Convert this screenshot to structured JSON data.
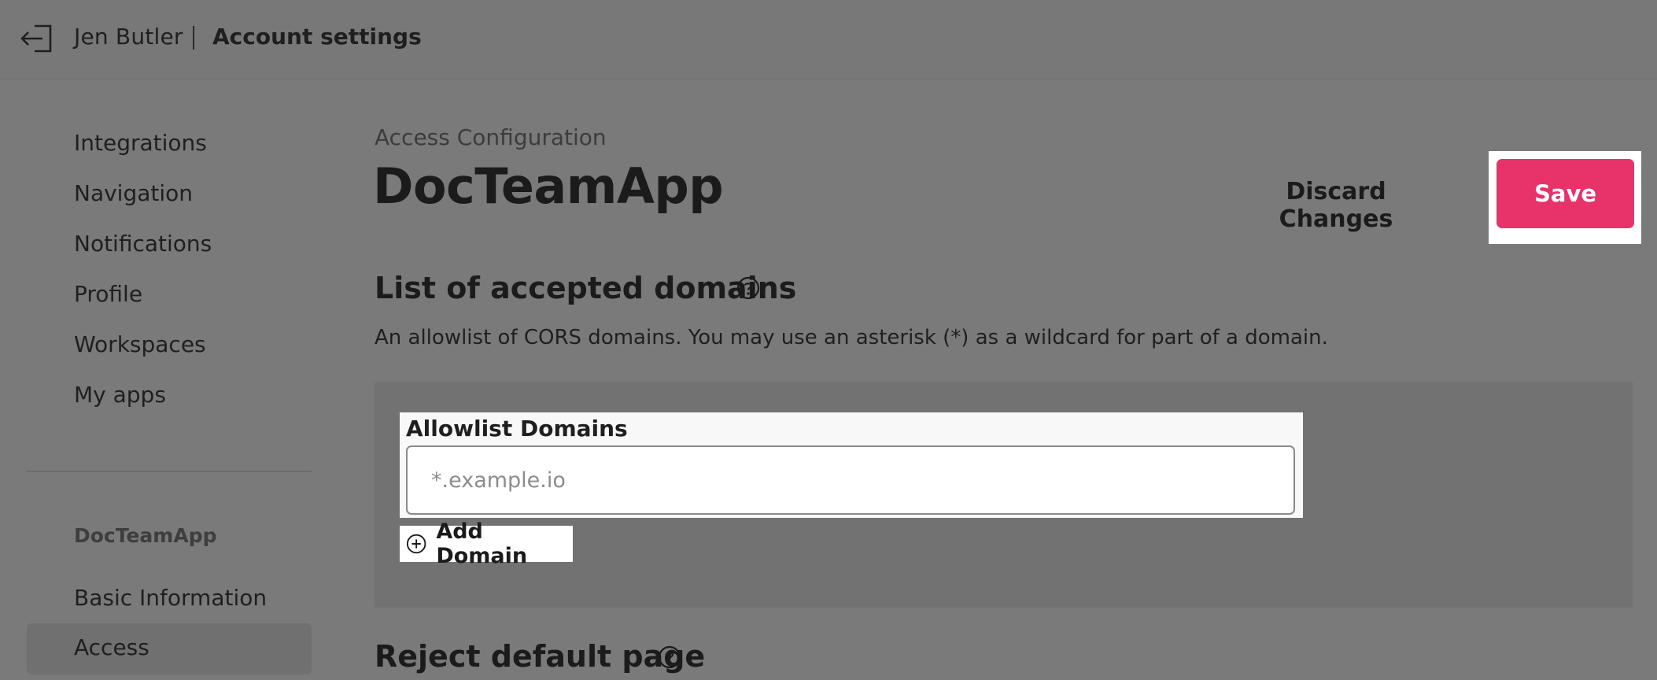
{
  "header": {
    "user_name": "Jen Butler",
    "page_name": "Account settings",
    "exit_icon": "exit-icon"
  },
  "sidebar": {
    "items": [
      {
        "label": "Integrations"
      },
      {
        "label": "Navigation"
      },
      {
        "label": "Notifications"
      },
      {
        "label": "Profile"
      },
      {
        "label": "Workspaces"
      },
      {
        "label": "My apps"
      }
    ],
    "section_title": "DocTeamApp",
    "section_items": [
      {
        "label": "Basic Information"
      },
      {
        "label": "Access",
        "active": true
      }
    ]
  },
  "main": {
    "breadcrumb": "Access Configuration",
    "title": "DocTeamApp",
    "discard_label": "Discard Changes",
    "save_label": "Save",
    "domains_section": {
      "title": "List of accepted domains",
      "description": "An allowlist of CORS domains. You may use an asterisk (*) as a wildcard for part of a domain.",
      "field_label": "Allowlist Domains",
      "field_placeholder": "*.example.io",
      "field_value": "",
      "add_label": "Add Domain"
    },
    "reject_section": {
      "title": "Reject default page"
    }
  },
  "colors": {
    "accent": "#e8336a",
    "overlay_bg": "#7a7a7a"
  }
}
